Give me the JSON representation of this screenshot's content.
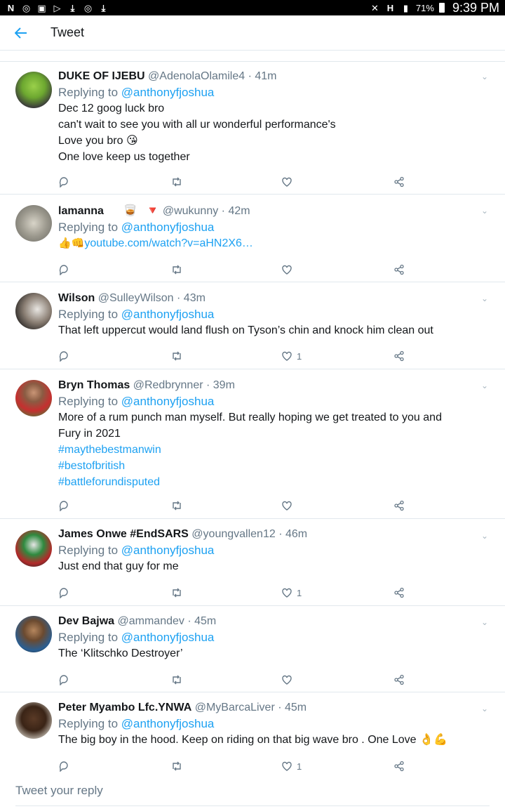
{
  "status_bar": {
    "left_icons": [
      "N",
      "chrome-icon",
      "gallery-icon",
      "play-icon",
      "download-icon",
      "chrome-icon",
      "download-icon"
    ],
    "battery": "71%",
    "time": "9:39 PM"
  },
  "header": {
    "title": "Tweet"
  },
  "tweets": [
    {
      "name": "DUKE OF IJEBU",
      "handle": "@AdenolaOlamile4",
      "time": "· 41m",
      "replying_prefix": "Replying to ",
      "replying_to": "@anthonyfjoshua",
      "lines": [
        "Dec 12 goog luck bro",
        "can't wait to see you with all ur wonderful performance's",
        "Love you bro 😘",
        "One love keep us together"
      ],
      "likes": ""
    },
    {
      "name": "lamanna",
      "name_suffix": "⠀⠀🥃⠀🔻",
      "handle": "@wukunny",
      "time": "· 42m",
      "replying_prefix": "Replying to ",
      "replying_to": "@anthonyfjoshua",
      "link_prefix": "👍👊",
      "link": "youtube.com/watch?v=aHN2X6…",
      "likes": ""
    },
    {
      "name": "Wilson",
      "handle": "@SulleyWilson",
      "time": "· 43m",
      "replying_prefix": "Replying to ",
      "replying_to": "@anthonyfjoshua",
      "lines": [
        "That left uppercut would land flush on Tyson’s chin and knock him clean out"
      ],
      "likes": "1"
    },
    {
      "name": "Bryn Thomas",
      "handle": "@Redbrynner",
      "time": "· 39m",
      "replying_prefix": "Replying to ",
      "replying_to": "@anthonyfjoshua",
      "lines": [
        "More of a rum punch man myself. But really hoping we get treated to you and",
        "Fury in 2021"
      ],
      "hashtags": [
        "#maythebestmanwin",
        "#bestofbritish",
        "#battleforundisputed"
      ],
      "likes": ""
    },
    {
      "name": "James Onwe #EndSARS",
      "handle": "@youngvallen12",
      "time": "· 46m",
      "replying_prefix": "Replying to ",
      "replying_to": "@anthonyfjoshua",
      "lines": [
        "Just end that guy for me"
      ],
      "likes": "1"
    },
    {
      "name": "Dev Bajwa",
      "handle": "@ammandev",
      "time": "· 45m",
      "replying_prefix": "Replying to ",
      "replying_to": "@anthonyfjoshua",
      "lines": [
        "The ‘Klitschko Destroyer’"
      ],
      "likes": ""
    },
    {
      "name": "Peter Myambo Lfc.YNWA",
      "handle": "@MyBarcaLiver",
      "time": "· 45m",
      "replying_prefix": "Replying to ",
      "replying_to": "@anthonyfjoshua",
      "lines": [
        "The big boy in the hood. Keep on riding on that big wave bro . One Love 👌💪"
      ],
      "likes": "1"
    }
  ],
  "reply_box": {
    "placeholder": "Tweet your reply"
  },
  "colors": {
    "accent": "#1da1f2",
    "muted": "#657786",
    "divider": "#e1e8ed"
  }
}
